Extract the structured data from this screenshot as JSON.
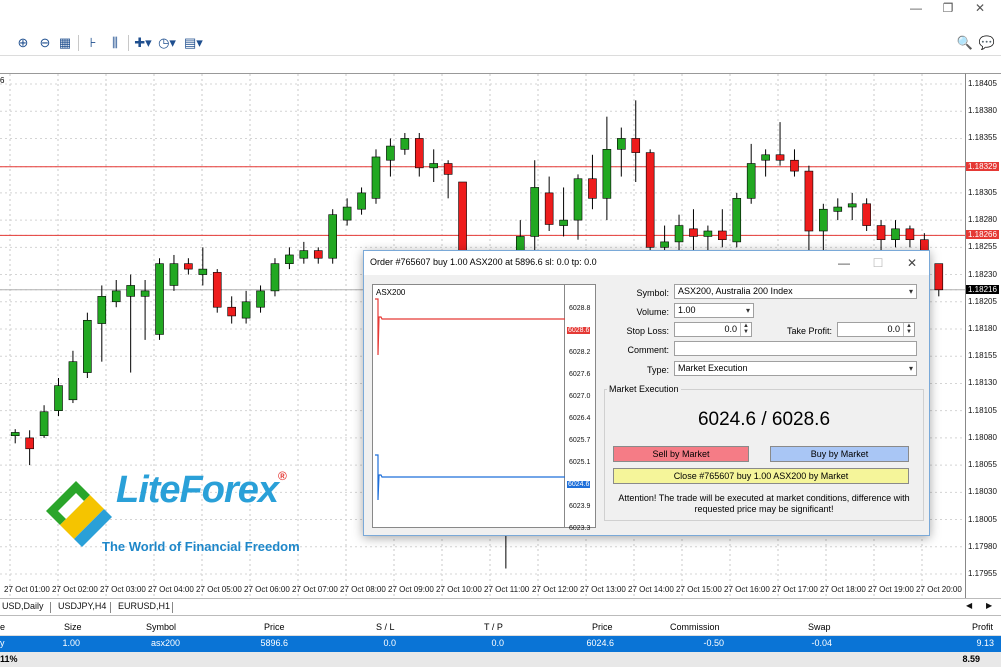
{
  "window": {
    "min": "—",
    "restore": "❐",
    "close": "✕"
  },
  "toolbar_icons": [
    "zoom-in-icon",
    "zoom-out-icon",
    "tile-windows-icon",
    "chart-shift-icon",
    "autoscroll-icon",
    "indicators-icon",
    "periods-icon",
    "templates-icon"
  ],
  "toolbar_right": {
    "search": "🔍",
    "chat": "💬"
  },
  "chart": {
    "corner_label": "6",
    "hlines": [
      "1.18329",
      "1.18266"
    ],
    "current_price": "1.18216",
    "y_ticks": [
      "1.18405",
      "1.18380",
      "1.18355",
      "1.18329",
      "1.18305",
      "1.18280",
      "1.18266",
      "1.18255",
      "1.18230",
      "1.18216",
      "1.18205",
      "1.18180",
      "1.18155",
      "1.18130",
      "1.18105",
      "1.18080",
      "1.18055",
      "1.18030",
      "1.18005",
      "1.17980",
      "1.17955"
    ],
    "x_ticks": [
      "27 Oct 01:00",
      "27 Oct 02:00",
      "27 Oct 03:00",
      "27 Oct 04:00",
      "27 Oct 05:00",
      "27 Oct 06:00",
      "27 Oct 07:00",
      "27 Oct 08:00",
      "27 Oct 09:00",
      "27 Oct 10:00",
      "27 Oct 11:00",
      "27 Oct 12:00",
      "27 Oct 13:00",
      "27 Oct 14:00",
      "27 Oct 15:00",
      "27 Oct 16:00",
      "27 Oct 17:00",
      "27 Oct 18:00",
      "27 Oct 19:00",
      "27 Oct 20:00"
    ]
  },
  "chart_data": {
    "type": "candlestick",
    "y_range": [
      1.17955,
      1.18405
    ],
    "candles": [
      [
        1.18082,
        1.18088,
        1.18075,
        1.18085
      ],
      [
        1.1808,
        1.18087,
        1.18055,
        1.1807
      ],
      [
        1.18082,
        1.1811,
        1.1808,
        1.18104
      ],
      [
        1.18105,
        1.18135,
        1.181,
        1.18128
      ],
      [
        1.18115,
        1.1816,
        1.18112,
        1.1815
      ],
      [
        1.1814,
        1.18195,
        1.18135,
        1.18188
      ],
      [
        1.18185,
        1.1822,
        1.1815,
        1.1821
      ],
      [
        1.18205,
        1.18225,
        1.182,
        1.18215
      ],
      [
        1.1821,
        1.1823,
        1.1814,
        1.1822
      ],
      [
        1.1821,
        1.18225,
        1.1817,
        1.18215
      ],
      [
        1.18175,
        1.18245,
        1.1817,
        1.1824
      ],
      [
        1.1822,
        1.18248,
        1.18215,
        1.1824
      ],
      [
        1.1824,
        1.18245,
        1.1823,
        1.18235
      ],
      [
        1.1823,
        1.18255,
        1.1822,
        1.18235
      ],
      [
        1.18232,
        1.18235,
        1.18195,
        1.182
      ],
      [
        1.182,
        1.1821,
        1.18185,
        1.18192
      ],
      [
        1.1819,
        1.18215,
        1.18185,
        1.18205
      ],
      [
        1.182,
        1.1822,
        1.18195,
        1.18215
      ],
      [
        1.18215,
        1.18245,
        1.1821,
        1.1824
      ],
      [
        1.1824,
        1.18255,
        1.18235,
        1.18248
      ],
      [
        1.18245,
        1.1826,
        1.1824,
        1.18252
      ],
      [
        1.18252,
        1.18255,
        1.1824,
        1.18245
      ],
      [
        1.18245,
        1.1829,
        1.1824,
        1.18285
      ],
      [
        1.1828,
        1.183,
        1.18275,
        1.18292
      ],
      [
        1.1829,
        1.1831,
        1.18285,
        1.18305
      ],
      [
        1.183,
        1.18345,
        1.18295,
        1.18338
      ],
      [
        1.18335,
        1.18355,
        1.1832,
        1.18348
      ],
      [
        1.18345,
        1.1836,
        1.1834,
        1.18355
      ],
      [
        1.18355,
        1.1836,
        1.1832,
        1.18328
      ],
      [
        1.18328,
        1.18345,
        1.18315,
        1.18332
      ],
      [
        1.18332,
        1.18335,
        1.183,
        1.18322
      ],
      [
        1.18315,
        1.18315,
        1.1819,
        1.18238
      ],
      [
        1.1824,
        1.1825,
        1.1822,
        1.18232
      ],
      [
        1.1823,
        1.1823,
        1.1822,
        1.18225
      ],
      [
        1.18225,
        1.18228,
        1.1796,
        1.181
      ],
      [
        1.1825,
        1.1828,
        1.1824,
        1.18265
      ],
      [
        1.18265,
        1.18335,
        1.1824,
        1.1831
      ],
      [
        1.18305,
        1.1832,
        1.1827,
        1.18276
      ],
      [
        1.18275,
        1.1831,
        1.18265,
        1.1828
      ],
      [
        1.1828,
        1.18322,
        1.18262,
        1.18318
      ],
      [
        1.18318,
        1.1834,
        1.1829,
        1.183
      ],
      [
        1.183,
        1.18375,
        1.1828,
        1.18345
      ],
      [
        1.18345,
        1.18365,
        1.1832,
        1.18355
      ],
      [
        1.18355,
        1.1839,
        1.18315,
        1.18342
      ],
      [
        1.18342,
        1.18345,
        1.1822,
        1.18255
      ],
      [
        1.18255,
        1.18275,
        1.1823,
        1.1826
      ],
      [
        1.1826,
        1.18285,
        1.18235,
        1.18275
      ],
      [
        1.18272,
        1.1829,
        1.1825,
        1.18265
      ],
      [
        1.18265,
        1.18275,
        1.1825,
        1.1827
      ],
      [
        1.1827,
        1.1829,
        1.18255,
        1.18262
      ],
      [
        1.1826,
        1.18305,
        1.18255,
        1.183
      ],
      [
        1.183,
        1.1835,
        1.18295,
        1.18332
      ],
      [
        1.18335,
        1.18345,
        1.1832,
        1.1834
      ],
      [
        1.1834,
        1.1837,
        1.1833,
        1.18335
      ],
      [
        1.18335,
        1.18345,
        1.1832,
        1.18325
      ],
      [
        1.18325,
        1.1833,
        1.1824,
        1.1827
      ],
      [
        1.1827,
        1.18295,
        1.1825,
        1.1829
      ],
      [
        1.18288,
        1.183,
        1.1828,
        1.18292
      ],
      [
        1.18292,
        1.18305,
        1.1828,
        1.18295
      ],
      [
        1.18295,
        1.183,
        1.1827,
        1.18275
      ],
      [
        1.18275,
        1.1828,
        1.1825,
        1.18262
      ],
      [
        1.18262,
        1.1828,
        1.18255,
        1.18272
      ],
      [
        1.18272,
        1.18275,
        1.18255,
        1.18262
      ],
      [
        1.18262,
        1.18268,
        1.182,
        1.1824
      ],
      [
        1.1824,
        1.1824,
        1.1821,
        1.18216
      ]
    ]
  },
  "dialog": {
    "title": "Order #765607 buy 1.00 ASX200 at 5896.6 sl: 0.0 tp: 0.0",
    "min": "—",
    "max": "☐",
    "close": "✕",
    "tick_chart": {
      "symbol": "ASX200",
      "labels": [
        "6028.8",
        "6028.6",
        "6028.2",
        "6027.6",
        "6027.0",
        "6026.4",
        "6025.7",
        "6025.1",
        "6024.6",
        "6023.9",
        "6023.3"
      ]
    },
    "symbol_label": "Symbol:",
    "symbol_value": "ASX200, Australia 200 Index",
    "volume_label": "Volume:",
    "volume_value": "1.00",
    "sl_label": "Stop Loss:",
    "sl_value": "0.0",
    "tp_label": "Take Profit:",
    "tp_value": "0.0",
    "comment_label": "Comment:",
    "type_label": "Type:",
    "type_value": "Market Execution",
    "group_label": "Market Execution",
    "quote": "6024.6 / 6028.6",
    "sell_btn": "Sell by Market",
    "buy_btn": "Buy by Market",
    "close_btn": "Close #765607 buy 1.00 ASX200 by Market",
    "warning": "Attention! The trade will be executed at market conditions, difference with requested price may be significant!",
    "colors": {
      "sell": "#f57c86",
      "buy": "#a9c6f5",
      "close": "#f5f59a"
    }
  },
  "logo": {
    "name": "LiteForex",
    "reg": "®",
    "tagline": "The World of Financial Freedom"
  },
  "tabs": [
    "USD,Daily",
    "USDJPY,H4",
    "EURUSD,H1"
  ],
  "terminal": {
    "headers": [
      "e",
      "Size",
      "Symbol",
      "Price",
      "S / L",
      "T / P",
      "Price",
      "Commission",
      "Swap",
      "Profit"
    ],
    "row": [
      "y",
      "1.00",
      "asx200",
      "5896.6",
      "0.0",
      "0.0",
      "6024.6",
      "-0.50",
      "-0.04",
      "9.13"
    ],
    "footer_left": "11%",
    "footer_profit": "8.59"
  }
}
